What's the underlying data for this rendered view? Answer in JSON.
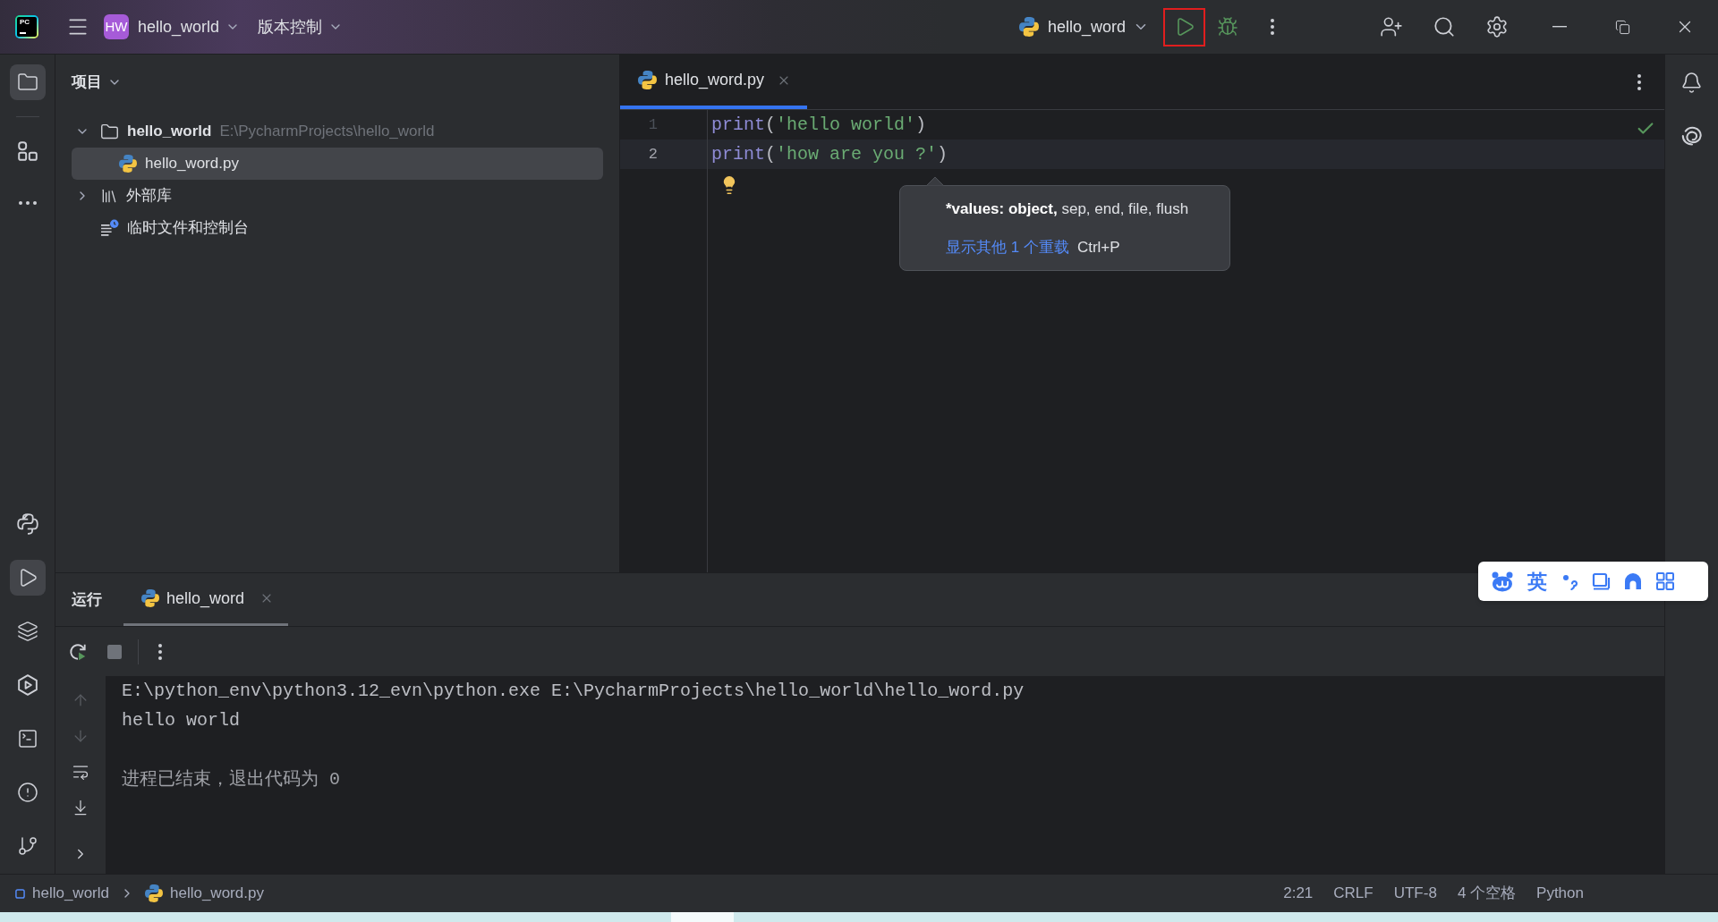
{
  "app_logo": {
    "text": "PC"
  },
  "title_bar": {
    "project_badge": "HW",
    "project_name": "hello_world",
    "vcs_menu": "版本控制",
    "run_config": "hello_word"
  },
  "left_toolbar": {
    "top": [
      {
        "selected": true
      },
      {
        "selected": false
      },
      {
        "selected": false
      }
    ],
    "bottom": [
      {
        "selected": false
      },
      {
        "selected": true
      },
      {
        "selected": false
      },
      {
        "selected": false
      },
      {
        "selected": false
      },
      {
        "selected": false
      },
      {
        "selected": false
      }
    ]
  },
  "project_panel": {
    "title": "项目",
    "tree": [
      {
        "kind": "project",
        "label": "hello_world",
        "path": "E:\\PycharmProjects\\hello_world",
        "expanded": true,
        "selected": false,
        "children": [
          {
            "kind": "python",
            "label": "hello_word.py",
            "selected": true
          }
        ]
      },
      {
        "kind": "library",
        "label": "外部库",
        "expanded": false,
        "selected": false
      },
      {
        "kind": "scratches",
        "label": "临时文件和控制台",
        "selected": false
      }
    ]
  },
  "editor": {
    "tabs": [
      {
        "label": "hello_word.py",
        "selected": true
      }
    ],
    "lines": [
      {
        "number": "1",
        "current": false,
        "tokens": [
          {
            "kind": "builtin",
            "text": "print"
          },
          {
            "kind": "punct",
            "text": "("
          },
          {
            "kind": "string",
            "text": "'hello world'"
          },
          {
            "kind": "punct",
            "text": ")"
          }
        ]
      },
      {
        "number": "2",
        "current": true,
        "tokens": [
          {
            "kind": "builtin",
            "text": "print"
          },
          {
            "kind": "punct",
            "text": "("
          },
          {
            "kind": "string",
            "text": "'how are you ?'"
          },
          {
            "kind": "punct",
            "text": ")"
          }
        ]
      }
    ],
    "param_info": {
      "current_param": "*values: object,",
      "other_params": "sep, end, file, flush",
      "link": "显示其他 1 个重载",
      "shortcut": "Ctrl+P"
    }
  },
  "run_panel": {
    "title": "运行",
    "tabs": [
      {
        "label": "hello_word",
        "selected": true
      }
    ],
    "console_tools": [
      {
        "disabled": true
      },
      {
        "disabled": true
      },
      {
        "disabled": false
      },
      {
        "disabled": false
      }
    ],
    "console": [
      {
        "kind": "command",
        "text": "E:\\python_env\\python3.12_evn\\python.exe E:\\PycharmProjects\\hello_world\\hello_word.py"
      },
      {
        "kind": "output",
        "text": "hello world"
      },
      {
        "kind": "exit",
        "text": "进程已结束，退出代码为 0"
      }
    ]
  },
  "status_bar": {
    "breadcrumbs": [
      {
        "kind": "module",
        "label": "hello_world"
      },
      {
        "kind": "python",
        "label": "hello_word.py"
      }
    ],
    "items": [
      "2:21",
      "CRLF",
      "UTF-8",
      "4 个空格",
      "Python"
    ]
  },
  "ime_toolbar": {
    "language": "英"
  }
}
